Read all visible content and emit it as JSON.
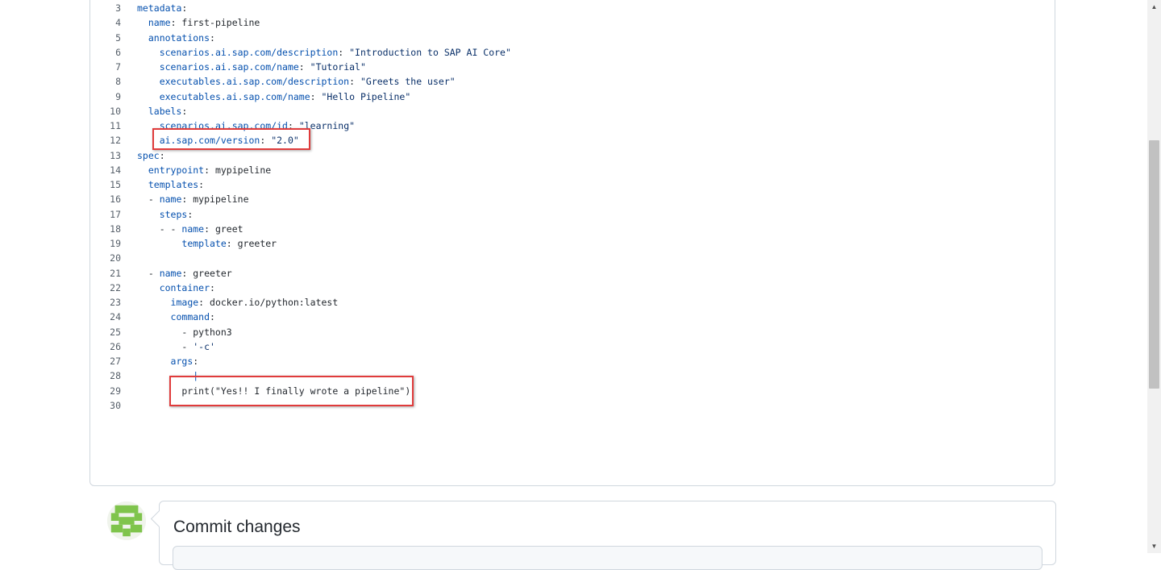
{
  "editor": {
    "lines": [
      {
        "n": "3",
        "segs": [
          {
            "t": "metadata",
            "c": "k"
          },
          {
            "t": ":",
            "c": "p"
          }
        ]
      },
      {
        "n": "4",
        "segs": [
          {
            "t": "  "
          },
          {
            "t": "name",
            "c": "k"
          },
          {
            "t": ": first-pipeline",
            "c": "p"
          }
        ]
      },
      {
        "n": "5",
        "segs": [
          {
            "t": "  "
          },
          {
            "t": "annotations",
            "c": "k"
          },
          {
            "t": ":",
            "c": "p"
          }
        ]
      },
      {
        "n": "6",
        "segs": [
          {
            "t": "    "
          },
          {
            "t": "scenarios.ai.sap.com/description",
            "c": "k"
          },
          {
            "t": ": ",
            "c": "p"
          },
          {
            "t": "\"Introduction to SAP AI Core\"",
            "c": "s"
          }
        ]
      },
      {
        "n": "7",
        "segs": [
          {
            "t": "    "
          },
          {
            "t": "scenarios.ai.sap.com/name",
            "c": "k"
          },
          {
            "t": ": ",
            "c": "p"
          },
          {
            "t": "\"Tutorial\"",
            "c": "s"
          }
        ]
      },
      {
        "n": "8",
        "segs": [
          {
            "t": "    "
          },
          {
            "t": "executables.ai.sap.com/description",
            "c": "k"
          },
          {
            "t": ": ",
            "c": "p"
          },
          {
            "t": "\"Greets the user\"",
            "c": "s"
          }
        ]
      },
      {
        "n": "9",
        "segs": [
          {
            "t": "    "
          },
          {
            "t": "executables.ai.sap.com/name",
            "c": "k"
          },
          {
            "t": ": ",
            "c": "p"
          },
          {
            "t": "\"Hello Pipeline\"",
            "c": "s"
          }
        ]
      },
      {
        "n": "10",
        "segs": [
          {
            "t": "  "
          },
          {
            "t": "labels",
            "c": "k"
          },
          {
            "t": ":",
            "c": "p"
          }
        ]
      },
      {
        "n": "11",
        "segs": [
          {
            "t": "    "
          },
          {
            "t": "scenarios.ai.sap.com/id",
            "c": "k"
          },
          {
            "t": ": ",
            "c": "p"
          },
          {
            "t": "\"learning\"",
            "c": "s"
          }
        ]
      },
      {
        "n": "12",
        "segs": [
          {
            "t": "    "
          },
          {
            "t": "ai.sap.com/version",
            "c": "k"
          },
          {
            "t": ": ",
            "c": "p"
          },
          {
            "t": "\"2.0\"",
            "c": "s"
          }
        ]
      },
      {
        "n": "13",
        "segs": [
          {
            "t": "spec",
            "c": "k"
          },
          {
            "t": ":",
            "c": "p"
          }
        ]
      },
      {
        "n": "14",
        "segs": [
          {
            "t": "  "
          },
          {
            "t": "entrypoint",
            "c": "k"
          },
          {
            "t": ": mypipeline",
            "c": "p"
          }
        ]
      },
      {
        "n": "15",
        "segs": [
          {
            "t": "  "
          },
          {
            "t": "templates",
            "c": "k"
          },
          {
            "t": ":",
            "c": "p"
          }
        ]
      },
      {
        "n": "16",
        "segs": [
          {
            "t": "  - "
          },
          {
            "t": "name",
            "c": "k"
          },
          {
            "t": ": mypipeline",
            "c": "p"
          }
        ]
      },
      {
        "n": "17",
        "segs": [
          {
            "t": "    "
          },
          {
            "t": "steps",
            "c": "k"
          },
          {
            "t": ":",
            "c": "p"
          }
        ]
      },
      {
        "n": "18",
        "segs": [
          {
            "t": "    - - "
          },
          {
            "t": "name",
            "c": "k"
          },
          {
            "t": ": greet",
            "c": "p"
          }
        ]
      },
      {
        "n": "19",
        "segs": [
          {
            "t": "        "
          },
          {
            "t": "template",
            "c": "k"
          },
          {
            "t": ": greeter",
            "c": "p"
          }
        ]
      },
      {
        "n": "20",
        "segs": []
      },
      {
        "n": "21",
        "segs": [
          {
            "t": "  - "
          },
          {
            "t": "name",
            "c": "k"
          },
          {
            "t": ": greeter",
            "c": "p"
          }
        ]
      },
      {
        "n": "22",
        "segs": [
          {
            "t": "    "
          },
          {
            "t": "container",
            "c": "k"
          },
          {
            "t": ":",
            "c": "p"
          }
        ]
      },
      {
        "n": "23",
        "segs": [
          {
            "t": "      "
          },
          {
            "t": "image",
            "c": "k"
          },
          {
            "t": ": docker.io/python:latest",
            "c": "p"
          }
        ]
      },
      {
        "n": "24",
        "segs": [
          {
            "t": "      "
          },
          {
            "t": "command",
            "c": "k"
          },
          {
            "t": ":",
            "c": "p"
          }
        ]
      },
      {
        "n": "25",
        "segs": [
          {
            "t": "        - python3",
            "c": "p"
          }
        ]
      },
      {
        "n": "26",
        "segs": [
          {
            "t": "        - ",
            "c": "p"
          },
          {
            "t": "'-c'",
            "c": "s"
          }
        ]
      },
      {
        "n": "27",
        "segs": [
          {
            "t": "      "
          },
          {
            "t": "args",
            "c": "k"
          },
          {
            "t": ":",
            "c": "p"
          }
        ]
      },
      {
        "n": "28",
        "segs": [
          {
            "t": "        - ",
            "c": "p"
          },
          {
            "t": "|",
            "c": "k"
          }
        ]
      },
      {
        "n": "29",
        "segs": [
          {
            "t": "        print(\"Yes!! I finally wrote a pipeline\")",
            "c": "p"
          }
        ]
      },
      {
        "n": "30",
        "segs": []
      }
    ]
  },
  "commit": {
    "title": "Commit changes"
  },
  "colors": {
    "highlight": "#e03b3b",
    "key": "#0550ae",
    "string": "#0a3069"
  }
}
